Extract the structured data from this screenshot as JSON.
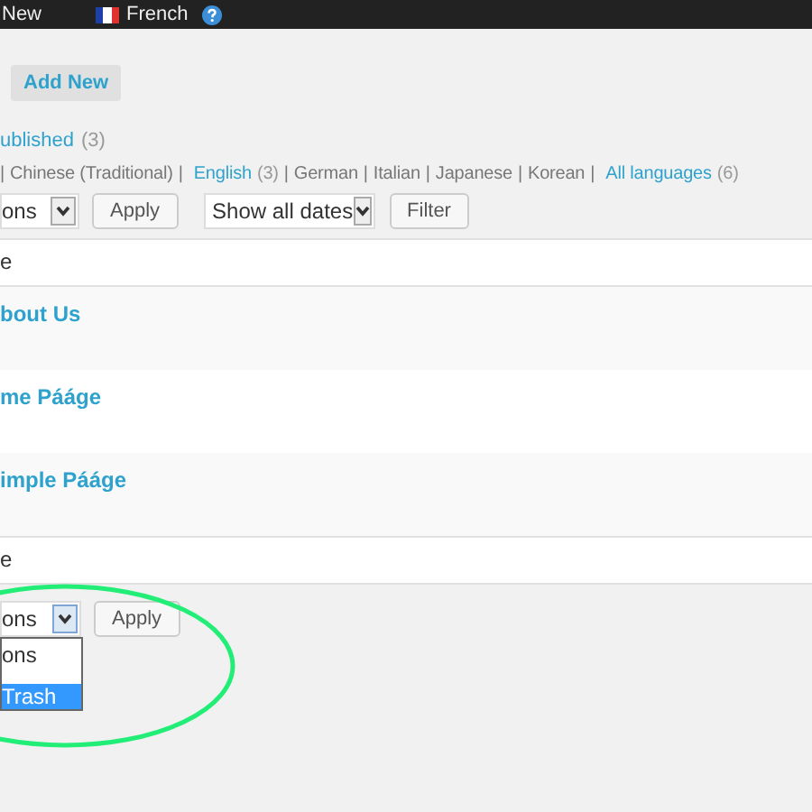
{
  "top_bar": {
    "items": [
      {
        "kind": "text",
        "label": "New"
      },
      {
        "kind": "flag",
        "label": "French"
      },
      {
        "kind": "help"
      }
    ]
  },
  "add_new_button": "Add New",
  "status_filters": [
    {
      "label": "ublished",
      "count": "(3)"
    }
  ],
  "language_filters": [
    {
      "kind": "separator",
      "label": "|"
    },
    {
      "kind": "plain",
      "label": "Chinese (Traditional)"
    },
    {
      "kind": "separator",
      "label": "|"
    },
    {
      "kind": "link",
      "label": "English",
      "count": "(3)"
    },
    {
      "kind": "separator",
      "label": "|"
    },
    {
      "kind": "plain",
      "label": "German"
    },
    {
      "kind": "separator",
      "label": "|"
    },
    {
      "kind": "plain",
      "label": "Italian"
    },
    {
      "kind": "separator",
      "label": "|"
    },
    {
      "kind": "plain",
      "label": "Japanese"
    },
    {
      "kind": "separator",
      "label": "|"
    },
    {
      "kind": "plain",
      "label": "Korean"
    },
    {
      "kind": "separator",
      "label": "|"
    },
    {
      "kind": "link",
      "label": "All languages",
      "count": "(6)"
    }
  ],
  "top_actions": {
    "bulk_select": "ons",
    "apply": "Apply",
    "date_select": "Show all dates",
    "filter": "Filter"
  },
  "table": {
    "header": "e",
    "rows": [
      "bout Us",
      "me Pááge",
      "imple Pááge"
    ],
    "footer": "e"
  },
  "bottom_actions": {
    "bulk_select": "ons",
    "apply": "Apply",
    "dropdown_open": true,
    "options": [
      {
        "label": "ons",
        "selected": false
      },
      {
        "label": "Trash",
        "selected": true
      }
    ]
  },
  "annotation": {
    "kind": "ellipse",
    "color": "#22ee77"
  }
}
